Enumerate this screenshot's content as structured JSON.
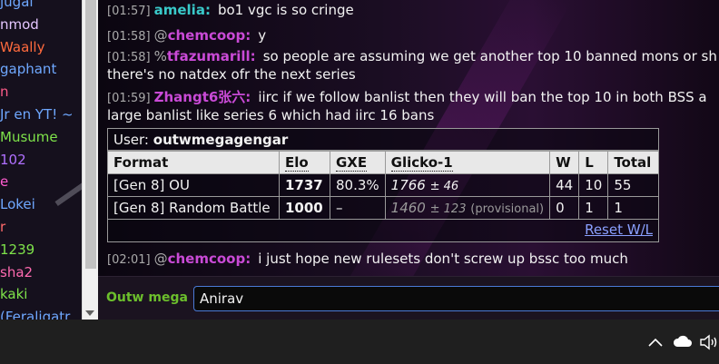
{
  "userlist": [
    {
      "name": "jugal",
      "color": "#6fa8ff"
    },
    {
      "name": "nmod",
      "color": "#e4c6ff"
    },
    {
      "name": "Waally",
      "color": "#ff6a3d"
    },
    {
      "name": "gaphant",
      "color": "#6fa8ff"
    },
    {
      "name": "n",
      "color": "#ff5c8a"
    },
    {
      "name": "Jr en YT! ~",
      "color": "#6fa8ff"
    },
    {
      "name": "Musume",
      "color": "#7ee24a"
    },
    {
      "name": "102",
      "color": "#b070ff"
    },
    {
      "name": "e",
      "color": "#ff5cd0"
    },
    {
      "name": "Lokei",
      "color": "#6fa8ff"
    },
    {
      "name": "r",
      "color": "#ff6a6a"
    },
    {
      "name": "1239",
      "color": "#7ee24a"
    },
    {
      "name": "sha2",
      "color": "#ff6ab0"
    },
    {
      "name": "kaki",
      "color": "#7ee24a"
    },
    {
      "name": "(Feraligatr",
      "color": "#6fa8ff"
    }
  ],
  "messages": [
    {
      "time": "[01:57]",
      "symbol": "",
      "user": "amelia:",
      "color": "#39c9c9",
      "text": "bo1 vgc is so cringe",
      "cont": ""
    },
    {
      "time": "[01:58]",
      "symbol": "@",
      "user": "chemcoop:",
      "color": "#c94ad6",
      "text": "y",
      "cont": ""
    },
    {
      "time": "[01:58]",
      "symbol": "%",
      "user": "tfazumarill:",
      "color": "#c94ad6",
      "text": "so people are assuming we get another top 10 banned mons or sh",
      "cont": "there's no natdex ofr the next series"
    },
    {
      "time": "[01:59]",
      "symbol": "",
      "user": "Zhangt6张六:",
      "color": "#c94ad6",
      "text": "iirc if we follow banlist then they will ban the top 10 in both BSS a",
      "cont": "large banlist like series 6 which had iirc 16 bans"
    },
    {
      "time": "[02:01]",
      "symbol": "@",
      "user": "chemcoop:",
      "color": "#c94ad6",
      "text": "i just hope new rulesets don't screw up bssc too much",
      "cont": ""
    }
  ],
  "card": {
    "user_label": "User:",
    "username": "outwmegagengar",
    "headers": [
      "Format",
      "Elo",
      "GXE",
      "Glicko-1",
      "W",
      "L",
      "Total"
    ],
    "rows": [
      {
        "format": "[Gen 8] OU",
        "elo": "1737",
        "gxe": "80.3%",
        "glicko": "1766",
        "glicko_dev": "± 46",
        "provisional": "",
        "w": "44",
        "l": "10",
        "total": "55"
      },
      {
        "format": "[Gen 8] Random Battle",
        "elo": "1000",
        "gxe": "–",
        "glicko": "1460",
        "glicko_dev": "± 123",
        "provisional": "(provisional)",
        "w": "0",
        "l": "1",
        "total": "1"
      }
    ],
    "reset_label": "Reset W/L"
  },
  "input": {
    "label": "Outw mega",
    "value": "Anirav"
  },
  "taskbar": {
    "icons": [
      "chevron-up-icon",
      "cloud-icon",
      "speaker-icon"
    ]
  }
}
